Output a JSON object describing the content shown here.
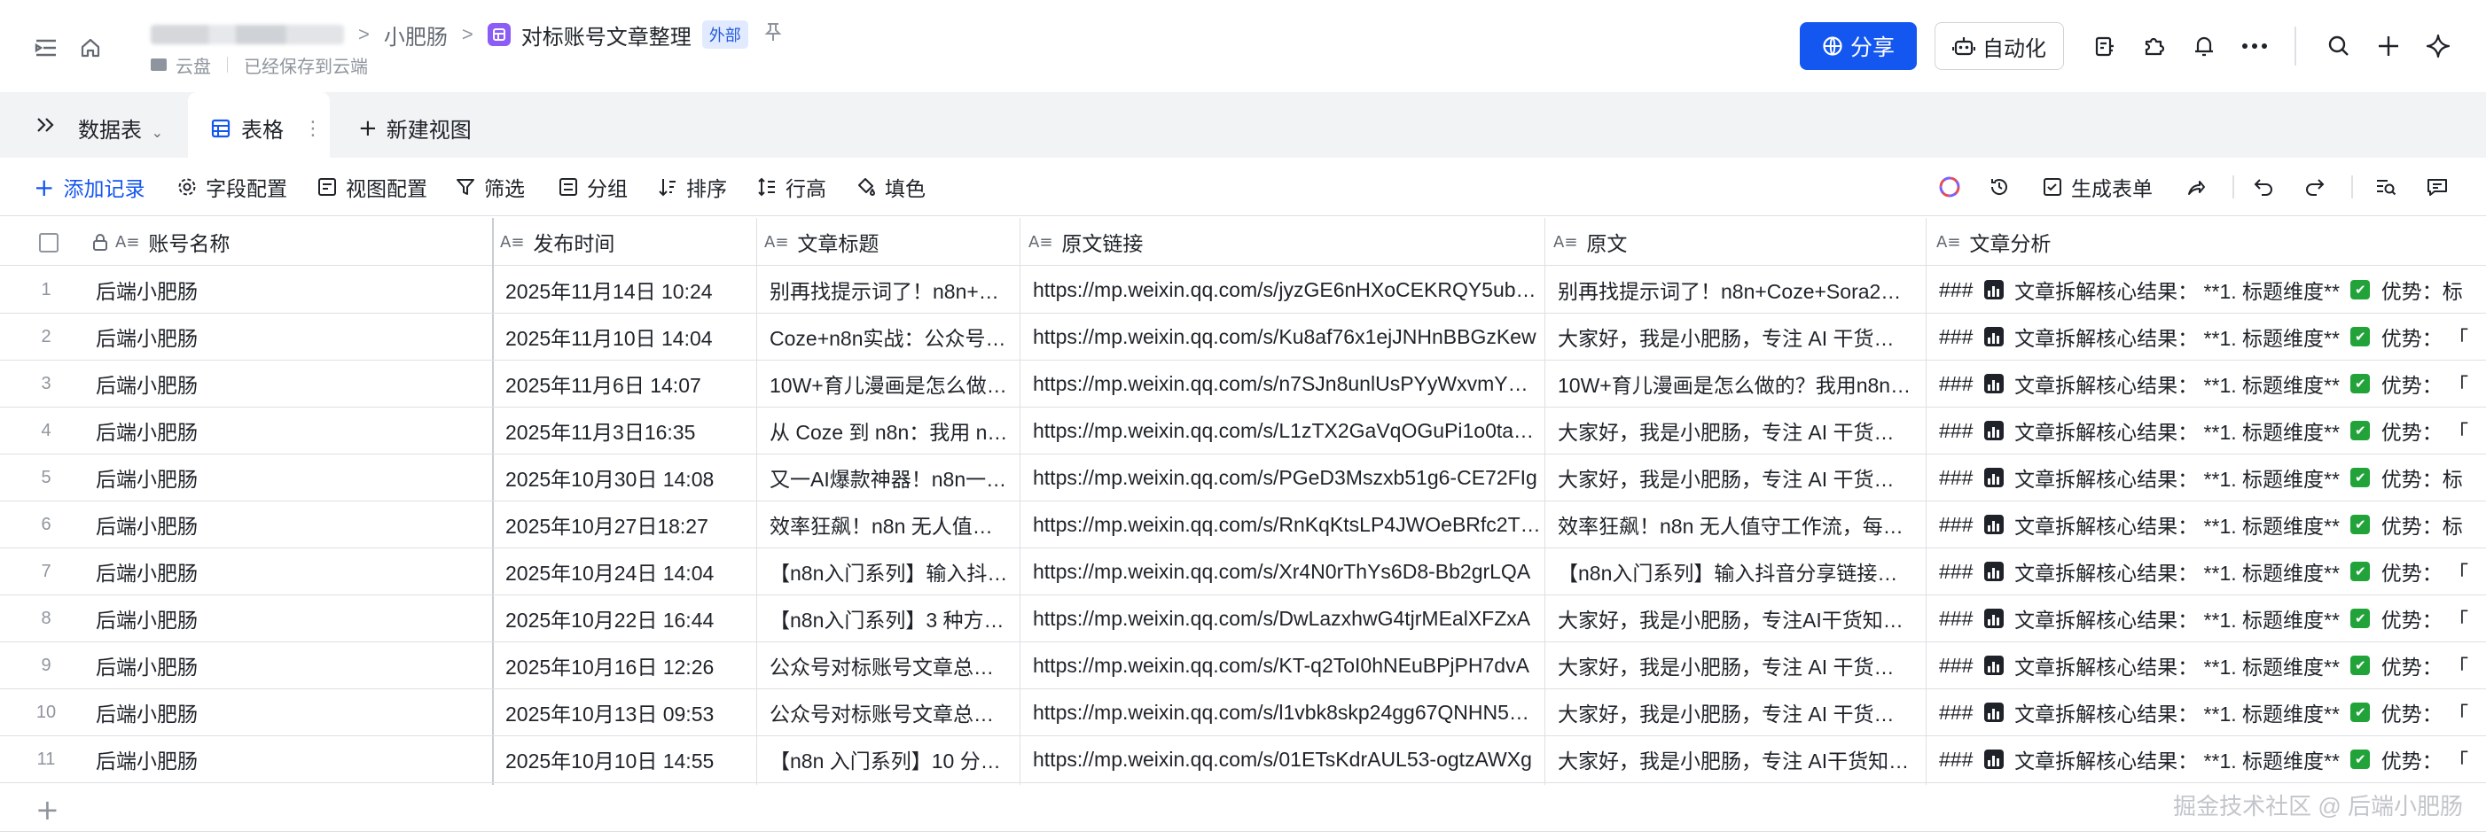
{
  "header": {
    "breadcrumb_parent": "小肥肠",
    "doc_title": "对标账号文章整理",
    "external_badge": "外部",
    "location": "云盘",
    "save_status": "已经保存到云端",
    "share_label": "分享",
    "automation_label": "自动化"
  },
  "tabs": {
    "datatable_label": "数据表",
    "grid_tab_label": "表格",
    "new_view_label": "新建视图"
  },
  "toolbar": {
    "add_record": "添加记录",
    "field_config": "字段配置",
    "view_config": "视图配置",
    "filter": "筛选",
    "group": "分组",
    "sort": "排序",
    "row_height": "行高",
    "fill_color": "填色",
    "generate_form": "生成表单"
  },
  "columns": {
    "account": "账号名称",
    "published": "发布时间",
    "title": "文章标题",
    "link": "原文链接",
    "content": "原文",
    "analysis": "文章分析"
  },
  "rows": [
    {
      "n": "1",
      "account": "后端小肥肠",
      "published": "2025年11月14日 10:24",
      "title": "别再找提示词了！n8n+…",
      "link": "https://mp.weixin.qq.com/s/jyzGE6nHXoCEKRQY5ub…",
      "content": "别再找提示词了！n8n+Coze+Sora2…",
      "a1": "### ",
      "a2": " 文章拆解核心结果： **1. 标题维度** ",
      "a3": " 优势：标"
    },
    {
      "n": "2",
      "account": "后端小肥肠",
      "published": "2025年11月10日 14:04",
      "title": "Coze+n8n实战：公众号…",
      "link": "https://mp.weixin.qq.com/s/Ku8af76x1ejJNHnBBGzKew",
      "content": "大家好，我是小肥肠，专注 AI 干货…",
      "a1": "### ",
      "a2": " 文章拆解核心结果： **1. 标题维度** ",
      "a3": " 优势： 「"
    },
    {
      "n": "3",
      "account": "后端小肥肠",
      "published": "2025年11月6日 14:07",
      "title": "10W+育儿漫画是怎么做…",
      "link": "https://mp.weixin.qq.com/s/n7SJn8unlUsPYyWxvmY…",
      "content": "10W+育儿漫画是怎么做的？我用n8n…",
      "a1": "### ",
      "a2": " 文章拆解核心结果： **1. 标题维度** ",
      "a3": " 优势： 「"
    },
    {
      "n": "4",
      "account": "后端小肥肠",
      "published": "2025年11月3日16:35",
      "title": "从 Coze 到 n8n：我用 n…",
      "link": "https://mp.weixin.qq.com/s/L1zTX2GaVqOGuPi1o0ta…",
      "content": "大家好，我是小肥肠，专注 AI 干货…",
      "a1": "### ",
      "a2": " 文章拆解核心结果： **1. 标题维度** ",
      "a3": " 优势： 「"
    },
    {
      "n": "5",
      "account": "后端小肥肠",
      "published": "2025年10月30日 14:08",
      "title": "又一AI爆款神器！n8n一…",
      "link": "https://mp.weixin.qq.com/s/PGeD3Mszxb51g6-CE72FIg",
      "content": "大家好，我是小肥肠，专注 AI 干货…",
      "a1": "### ",
      "a2": " 文章拆解核心结果： **1. 标题维度** ",
      "a3": " 优势：标"
    },
    {
      "n": "6",
      "account": "后端小肥肠",
      "published": "2025年10月27日18:27",
      "title": "效率狂飙！n8n 无人值…",
      "link": "https://mp.weixin.qq.com/s/RnKqKtsLP4JWOeBRfc2T…",
      "content": "效率狂飙！n8n 无人值守工作流，每…",
      "a1": "### ",
      "a2": " 文章拆解核心结果： **1. 标题维度** ",
      "a3": " 优势：标"
    },
    {
      "n": "7",
      "account": "后端小肥肠",
      "published": "2025年10月24日 14:04",
      "title": "【n8n入门系列】输入抖…",
      "link": "https://mp.weixin.qq.com/s/Xr4N0rThYs6D8-Bb2grLQA",
      "content": "【n8n入门系列】输入抖音分享链接…",
      "a1": "### ",
      "a2": " 文章拆解核心结果： **1. 标题维度** ",
      "a3": " 优势： 「"
    },
    {
      "n": "8",
      "account": "后端小肥肠",
      "published": "2025年10月22日 16:44",
      "title": "【n8n入门系列】3 种方…",
      "link": "https://mp.weixin.qq.com/s/DwLazxhwG4tjrMEalXFZxA",
      "content": "大家好，我是小肥肠，专注AI干货知…",
      "a1": "### ",
      "a2": " 文章拆解核心结果： **1. 标题维度** ",
      "a3": " 优势： 「"
    },
    {
      "n": "9",
      "account": "后端小肥肠",
      "published": "2025年10月16日 12:26",
      "title": "公众号对标账号文章总…",
      "link": "https://mp.weixin.qq.com/s/KT-q2ToI0hNEuBPjPH7dvA",
      "content": "大家好，我是小肥肠，专注 AI 干货…",
      "a1": "### ",
      "a2": " 文章拆解核心结果： **1. 标题维度** ",
      "a3": " 优势： 「"
    },
    {
      "n": "10",
      "account": "后端小肥肠",
      "published": "2025年10月13日 09:53",
      "title": "公众号对标账号文章总…",
      "link": "https://mp.weixin.qq.com/s/l1vbk8skp24gg67QNHN5…",
      "content": "大家好，我是小肥肠，专注 AI 干货…",
      "a1": "### ",
      "a2": " 文章拆解核心结果： **1. 标题维度** ",
      "a3": " 优势： 「"
    },
    {
      "n": "11",
      "account": "后端小肥肠",
      "published": "2025年10月10日 14:55",
      "title": "【n8n 入门系列】10 分…",
      "link": "https://mp.weixin.qq.com/s/01ETsKdrAUL53-ogtzAWXg",
      "content": "大家好，我是小肥肠，专注 AI干货知…",
      "a1": "### ",
      "a2": " 文章拆解核心结果： **1. 标题维度** ",
      "a3": " 优势： 「"
    }
  ],
  "footer": {
    "add_row": "+",
    "watermark": "掘金技术社区 @ 后端小肥肠"
  },
  "colors": {
    "accent": "#1456f0",
    "doc_icon": "#8b5cf6",
    "check_green": "#22a33a"
  },
  "icons": [
    "sidebar-toggle-icon",
    "home-icon",
    "pin-icon",
    "globe-icon",
    "robot-icon",
    "task-icon",
    "puzzle-icon",
    "bell-icon",
    "more-icon",
    "search-icon",
    "plus-icon",
    "sparkle-icon",
    "chevron-double-right-icon",
    "grid-icon",
    "gear-icon",
    "filter-icon",
    "sort-icon",
    "paint-icon",
    "undo-icon",
    "redo-icon"
  ]
}
